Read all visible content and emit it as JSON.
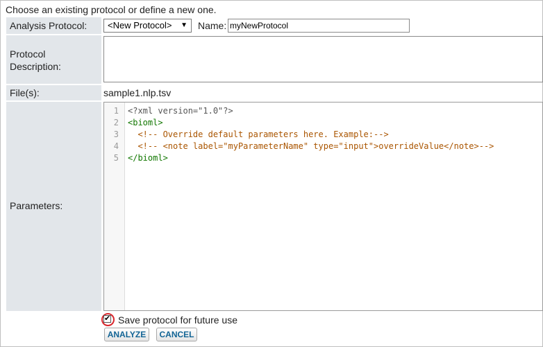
{
  "intro_text": "Choose an existing protocol or define a new one.",
  "fields": {
    "analysis_protocol_label": "Analysis Protocol:",
    "protocol_selected": "<New Protocol>",
    "name_label": "Name:",
    "name_value": "myNewProtocol",
    "description_label_line1": "Protocol",
    "description_label_line2": "Description:",
    "description_value": "",
    "files_label": "File(s):",
    "files_value": "sample1.nlp.tsv",
    "parameters_label": "Parameters:"
  },
  "editor": {
    "line_numbers": [
      "1",
      "2",
      "3",
      "4",
      "5"
    ],
    "lines": [
      "<?xml version=\"1.0\"?>",
      "<bioml>",
      "  <!-- Override default parameters here. Example:-->",
      "  <!-- <note label=\"myParameterName\" type=\"input\">overrideValue</note>-->",
      "</bioml>"
    ]
  },
  "save_checkbox": {
    "label": "Save protocol for future use",
    "checked": true
  },
  "buttons": {
    "analyze": "ANALYZE",
    "cancel": "CANCEL"
  },
  "colors": {
    "label_background": "#e2e6ea",
    "button_text": "#126495",
    "highlight_ring": "#d9262c",
    "xml_tag": "#117700",
    "xml_comment": "#aa5500"
  }
}
